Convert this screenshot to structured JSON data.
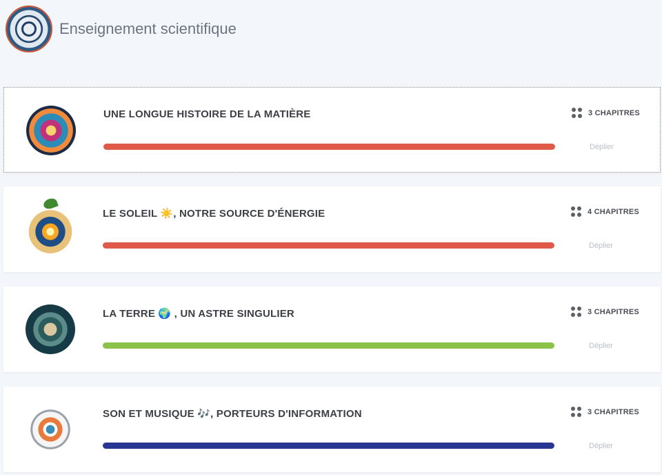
{
  "app": {
    "title": "Enseignement scientifique",
    "logo_icon": "science-emblem-icon"
  },
  "modules": [
    {
      "title": "UNE LONGUE HISTOIRE DE LA MATIÈRE",
      "chapters": "3 CHAPITRES",
      "toggle_label": "Déplier",
      "bar_color": "#e05a4a",
      "thumbnail_icon": "molecule-illustration-icon",
      "selected": true
    },
    {
      "title": "LE SOLEIL ☀️, NOTRE SOURCE D'ÉNERGIE",
      "chapters": "4 CHAPITRES",
      "toggle_label": "Déplier",
      "bar_color": "#e05a4a",
      "thumbnail_icon": "sun-energy-illustration-icon",
      "selected": false
    },
    {
      "title": "LA TERRE 🌍 , UN ASTRE SINGULIER",
      "chapters": "3 CHAPITRES",
      "toggle_label": "Déplier",
      "bar_color": "#8bc34a",
      "thumbnail_icon": "earth-illustration-icon",
      "selected": false
    },
    {
      "title": "SON ET MUSIQUE 🎶, PORTEURS D'INFORMATION",
      "chapters": "3 CHAPITRES",
      "toggle_label": "Déplier",
      "bar_color": "#283593",
      "thumbnail_icon": "ear-sound-illustration-icon",
      "selected": false
    }
  ]
}
